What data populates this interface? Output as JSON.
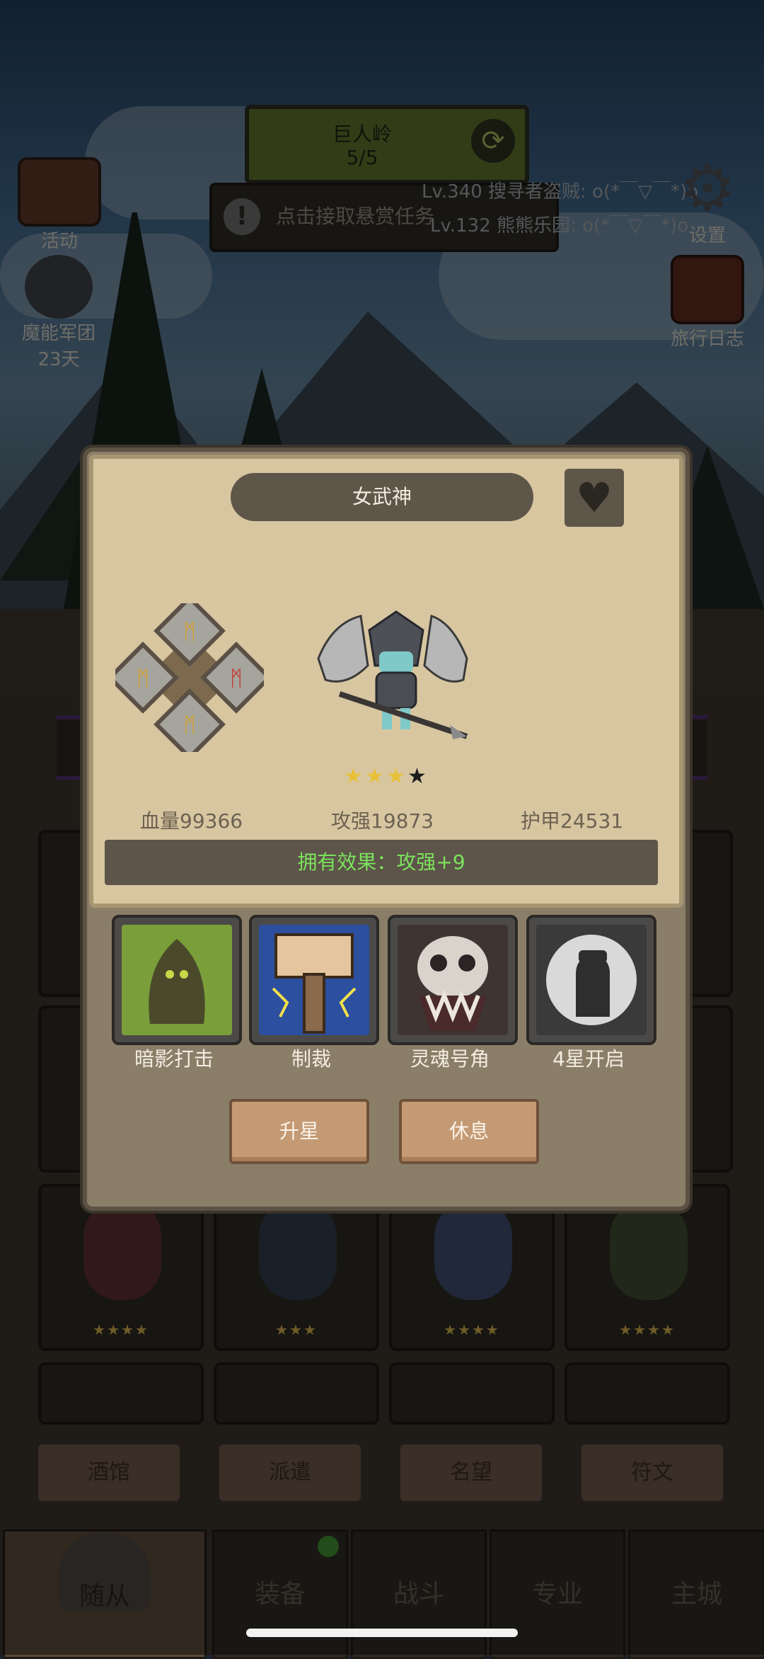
{
  "hud": {
    "area_name": "巨人岭",
    "area_progress": "5/5",
    "bounty_text": "点击接取悬赏任务",
    "ticker_1": "Lv.340 搜寻者盗贼: o(*￣▽￣*)o",
    "ticker_2": "Lv.132 熊熊乐园: o(*￣▽￣*)o"
  },
  "side": {
    "activity": "活动",
    "legion": "魔能军团",
    "legion_days": "23天",
    "settings": "设置",
    "journal": "旅行日志"
  },
  "hero_dialog": {
    "name": "女武神",
    "stars_filled": 3,
    "stars_total": 4,
    "hp": "血量99366",
    "atk": "攻强19873",
    "armor": "护甲24531",
    "effect": "拥有效果：攻强+9",
    "skills": [
      {
        "label": "暗影打击",
        "icon": "shadow-strike-icon"
      },
      {
        "label": "制裁",
        "icon": "hammer-icon"
      },
      {
        "label": "灵魂号角",
        "icon": "skull-horn-icon"
      },
      {
        "label": "4星开启",
        "icon": "locked-fist-icon"
      }
    ],
    "star_up_button": "升星",
    "rest_button": "休息"
  },
  "sub_tabs": [
    "酒馆",
    "派遣",
    "名望",
    "符文"
  ],
  "nav": {
    "followers": "随从",
    "equipment": "装备",
    "battle": "战斗",
    "profession": "专业",
    "main_city": "主城"
  },
  "colors": {
    "effect_text": "#7be35b",
    "star_gold": "#e8c13a",
    "panel": "#d8c6a1"
  }
}
